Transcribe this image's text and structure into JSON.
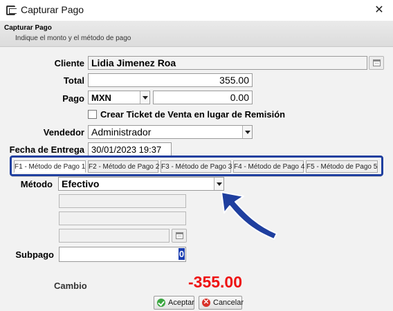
{
  "window": {
    "title": "Capturar Pago",
    "close_glyph": "✕"
  },
  "header": {
    "title": "Capturar Pago",
    "subtitle": "Indique el monto y el método de pago"
  },
  "form": {
    "cliente_label": "Cliente",
    "cliente_value": "Lidia Jimenez Roa",
    "total_label": "Total",
    "total_value": "355.00",
    "pago_label": "Pago",
    "currency": "MXN",
    "pago_amount": "0.00",
    "ticket_checkbox_label": "Crear Ticket de Venta en lugar de Remisión",
    "ticket_checked": false,
    "vendedor_label": "Vendedor",
    "vendedor_value": "Administrador",
    "fecha_label": "Fecha de Entrega",
    "fecha_value": "30/01/2023 19:37"
  },
  "tabs": [
    {
      "label": "F1 - Método de Pago 1",
      "active": true
    },
    {
      "label": "F2 - Método de Pago 2",
      "active": false
    },
    {
      "label": "F3 - Método de Pago 3",
      "active": false
    },
    {
      "label": "F4 - Método de Pago 4",
      "active": false
    },
    {
      "label": "F5 - Método de Pago 5",
      "active": false
    }
  ],
  "payment": {
    "metodo_label": "Método",
    "metodo_value": "Efectivo",
    "subpago_label": "Subpago",
    "subpago_value": "0"
  },
  "cambio": {
    "label": "Cambio",
    "value": "-355.00",
    "value_color": "#ee1111"
  },
  "buttons": {
    "accept": "Aceptar",
    "cancel": "Cancelar"
  },
  "colors": {
    "highlight_border": "#1f3f9f",
    "arrow": "#1f3f9f"
  },
  "icons": [
    "app-icon",
    "close-icon",
    "calendar-icon",
    "checkmark-icon",
    "cancel-x-icon",
    "pointer-arrow-icon"
  ]
}
